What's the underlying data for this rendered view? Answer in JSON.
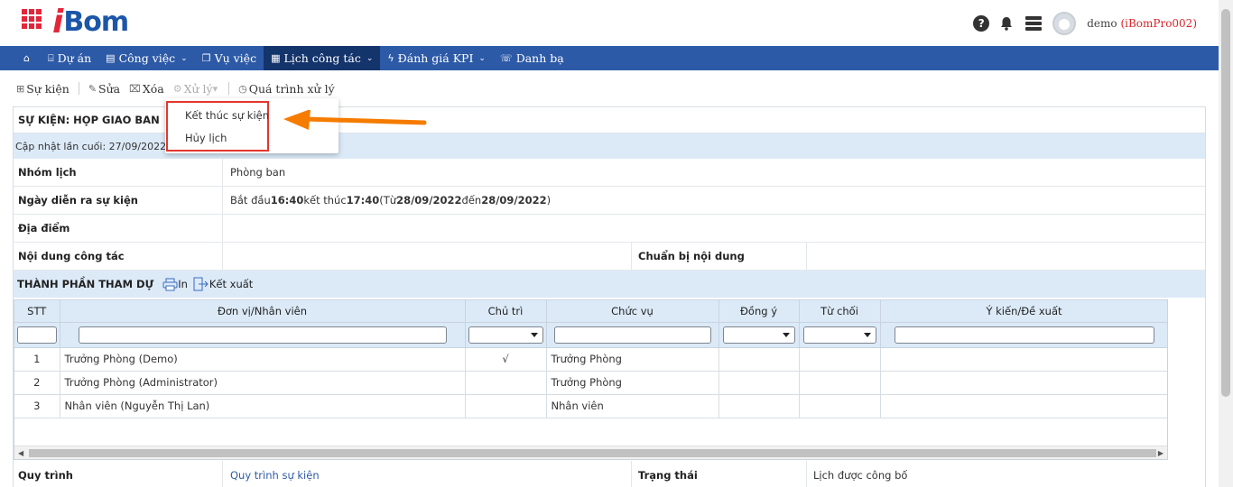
{
  "header": {
    "logo_initial": "i",
    "logo_rest": "Bom",
    "user_name": "demo",
    "org_code": "(iBomPro002)",
    "help_glyph": "?"
  },
  "nav": {
    "items": [
      {
        "label": "",
        "icon": "home-icon",
        "icon_glyph": "⌂"
      },
      {
        "label": "Dự án",
        "icon": "bank-icon",
        "icon_glyph": "⌸"
      },
      {
        "label": "Công việc",
        "icon": "calendar-icon",
        "icon_glyph": "▤",
        "has_chevron": true
      },
      {
        "label": "Vụ việc",
        "icon": "document-icon",
        "icon_glyph": "❐"
      },
      {
        "label": "Lịch công tác",
        "icon": "calendar-icon",
        "icon_glyph": "▦",
        "has_chevron": true,
        "active": true
      },
      {
        "label": "Đánh giá KPI",
        "icon": "bolt-icon",
        "icon_glyph": "ϟ",
        "has_chevron": true
      },
      {
        "label": "Danh bạ",
        "icon": "contact-icon",
        "icon_glyph": "☏"
      }
    ],
    "chevron": "⌄"
  },
  "toolbar": {
    "add_label": "Sự kiện",
    "edit_label": "Sửa",
    "delete_label": "Xóa",
    "process_label": "Xử lý",
    "history_label": "Quá trình xử lý"
  },
  "dropdown": {
    "items": [
      "Kết thúc sự kiện",
      "Hủy lịch"
    ]
  },
  "event": {
    "title": "SỰ KIỆN: HỌP GIAO BAN",
    "last_update": "Cập nhật lần cuối: 27/09/2022 4",
    "group_label": "Nhóm lịch",
    "group_value": "Phòng ban",
    "date_label": "Ngày diễn ra sự kiện",
    "date_start_prefix": "Bắt đầu ",
    "date_start": "16:40",
    "date_end_prefix": " kết thúc ",
    "date_end": "17:40",
    "date_range_prefix": " (Từ ",
    "date_from": "28/09/2022",
    "date_range_mid": " đến ",
    "date_to": "28/09/2022",
    "date_range_suffix": ")",
    "location_label": "Địa điểm",
    "content_label": "Nội dung công tác",
    "prep_label": "Chuẩn bị nội dung",
    "process_label": "Quy trình",
    "process_value": "Quy trình sự kiện",
    "status_label": "Trạng thái",
    "status_value": "Lịch được công bố"
  },
  "participants": {
    "section_title": "THÀNH PHẦN THAM DỰ",
    "print_label": "In",
    "export_label": "Kết xuất",
    "columns": [
      "STT",
      "Đơn vị/Nhân viên",
      "Chủ trì",
      "Chức vụ",
      "Đồng ý",
      "Từ chối",
      "Ý kiến/Đề xuất"
    ],
    "rows": [
      {
        "stt": "1",
        "name": "Trưởng Phòng (Demo)",
        "host": "√",
        "position": "Trưởng Phòng",
        "agree": "",
        "reject": "",
        "opinion": ""
      },
      {
        "stt": "2",
        "name": "Trưởng Phòng (Administrator)",
        "host": "",
        "position": "Trưởng Phòng",
        "agree": "",
        "reject": "",
        "opinion": ""
      },
      {
        "stt": "3",
        "name": "Nhân viên (Nguyễn Thị Lan)",
        "host": "",
        "position": "Nhân viên",
        "agree": "",
        "reject": "",
        "opinion": ""
      }
    ]
  },
  "colors": {
    "brand_red": "#e3263a",
    "brand_blue": "#1c56a8",
    "nav_bg": "#2d5aa7",
    "nav_active": "#14346c",
    "section_bg": "#dceaf8",
    "highlight_border": "#e4362d",
    "arrow": "#f57c00"
  }
}
